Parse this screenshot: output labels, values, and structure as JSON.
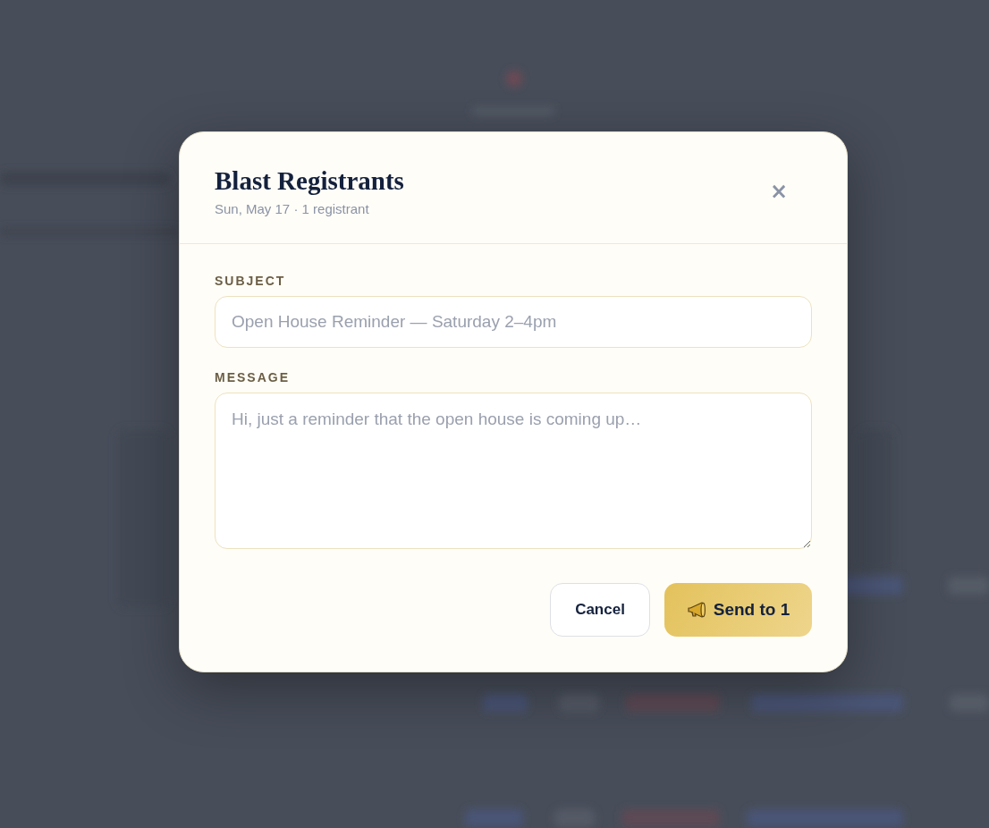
{
  "dialog": {
    "title": "Blast Registrants",
    "subtitle": "Sun, May 17 · 1 registrant",
    "close_label": "×"
  },
  "fields": [
    {
      "kind": "input",
      "label": "SUBJECT",
      "placeholder": "Open House Reminder — Saturday 2–4pm"
    },
    {
      "kind": "textarea",
      "label": "MESSAGE",
      "placeholder": "Hi, just a reminder that the open house is coming up…"
    }
  ],
  "buttons": [
    {
      "kind": "secondary",
      "label": "Cancel"
    },
    {
      "kind": "primary",
      "label": "Send to 1"
    }
  ]
}
